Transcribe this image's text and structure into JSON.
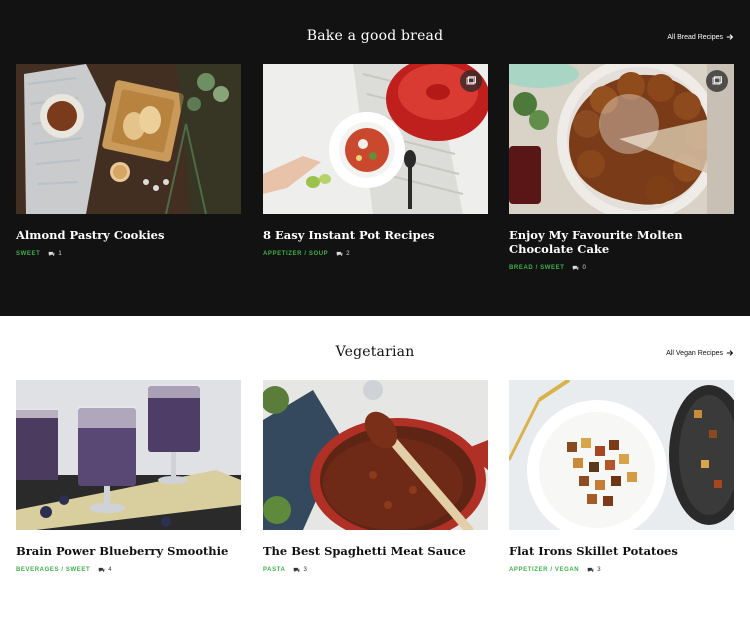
{
  "sections": [
    {
      "title": "Bake a good bread",
      "link_label": "All Bread Recipes",
      "cards": [
        {
          "title": "Almond Pastry Cookies",
          "categories": "SWEET",
          "comments": "1",
          "has_gallery": false
        },
        {
          "title": "8 Easy Instant Pot Recipes",
          "categories": "APPETIZER / SOUP",
          "comments": "2",
          "has_gallery": true
        },
        {
          "title": "Enjoy My Favourite Molten Chocolate Cake",
          "categories": "BREAD / SWEET",
          "comments": "0",
          "has_gallery": true
        }
      ]
    },
    {
      "title": "Vegetarian",
      "link_label": "All Vegan Recipes",
      "cards": [
        {
          "title": "Brain Power Blueberry Smoothie",
          "categories": "BEVERAGES / SWEET",
          "comments": "4",
          "has_gallery": false
        },
        {
          "title": "The Best Spaghetti Meat Sauce",
          "categories": "PASTA",
          "comments": "3",
          "has_gallery": false
        },
        {
          "title": "Flat Irons Skillet Potatoes",
          "categories": "APPETIZER / VEGAN",
          "comments": "3",
          "has_gallery": false
        }
      ]
    }
  ],
  "colors": {
    "dark_bg": "#121212",
    "accent": "#3fb14a"
  },
  "icons": {
    "link_arrow": "arrow-right-icon",
    "comment": "comment-icon",
    "gallery": "gallery-icon"
  }
}
